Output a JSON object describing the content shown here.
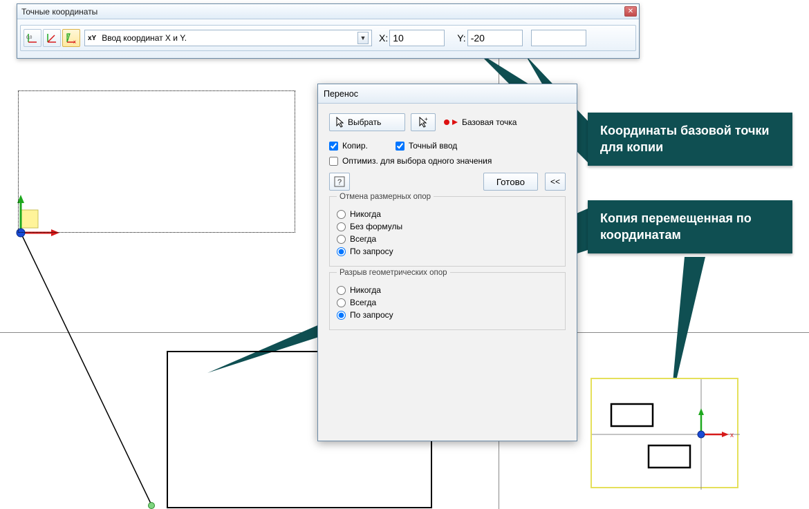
{
  "coord_win": {
    "title": "Точные координаты",
    "dropdown_prefix": "xY",
    "dropdown_text": "Ввод координат X и Y.",
    "x_label": "X:",
    "x_value": "10",
    "y_label": "Y:",
    "y_value": "-20"
  },
  "dlg": {
    "title": "Перенос",
    "select_btn": "Выбрать",
    "base_point_label": "Базовая точка",
    "copy_label": "Копир.",
    "precise_label": "Точный ввод",
    "optimize_label": "Оптимиз. для выбора одного значения",
    "done_btn": "Готово",
    "collapse_btn": "<<",
    "group1": {
      "legend": "Отмена размерных опор",
      "opt1": "Никогда",
      "opt2": "Без формулы",
      "opt3": "Всегда",
      "opt4": "По запросу"
    },
    "group2": {
      "legend": "Разрыв геометрических опор",
      "opt1": "Никогда",
      "opt2": "Всегда",
      "opt3": "По запросу"
    }
  },
  "callouts": {
    "c1": "Координаты базовой точки для копии",
    "c2": "Копия перемещенная по координатам"
  }
}
